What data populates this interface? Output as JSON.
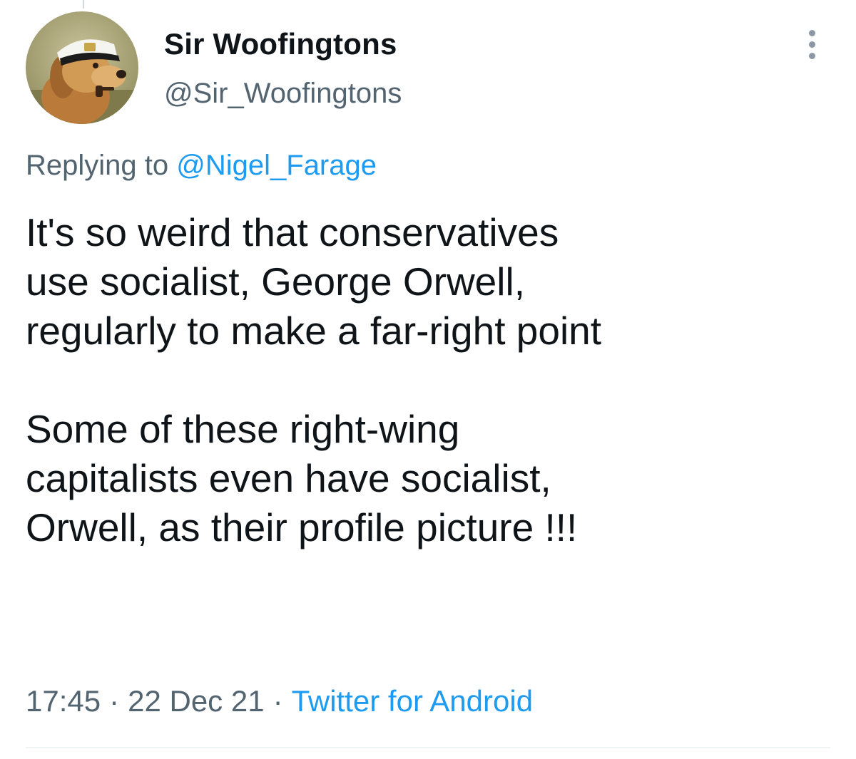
{
  "tweet": {
    "author": {
      "display_name": "Sir Woofingtons",
      "handle": "@Sir_Woofingtons",
      "avatar_icon": "dog-captain-hat-avatar"
    },
    "more_icon": "more-vertical-icon",
    "reply_prefix": "Replying to",
    "reply_to": "@Nigel_Farage",
    "paragraphs": [
      "It's so weird that conservatives\nuse socialist, George Orwell,\nregularly to make a far-right point",
      "Some of these right-wing\ncapitalists even have socialist,\nOrwell, as their profile picture !!!"
    ],
    "time": "17:45",
    "separator": "·",
    "date": "22 Dec 21",
    "source": "Twitter for Android"
  },
  "colors": {
    "text": "#0f1419",
    "secondary": "#536471",
    "link": "#1d9bf0",
    "divider": "#eff3f4"
  }
}
